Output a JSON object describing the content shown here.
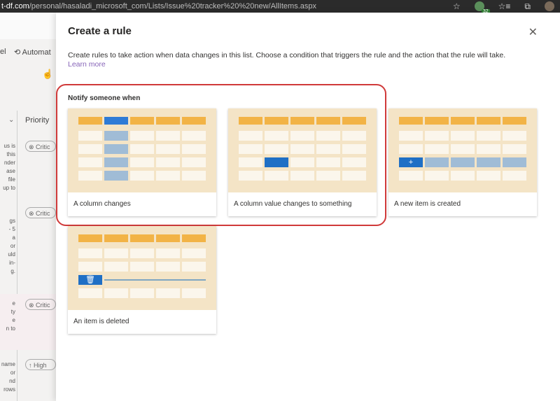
{
  "browser": {
    "url_domain": "t-df.com",
    "url_path": "/personal/hasaladi_microsoft_com/Lists/Issue%20tracker%20%20new/AllItems.aspx",
    "extension_badge": "32",
    "icons": [
      "star-icon",
      "extension-icon",
      "favorites-icon",
      "collections-icon",
      "profile-avatar"
    ]
  },
  "background": {
    "cmd_left": "el",
    "cmd_automate": "Automat",
    "column_priority": "Priority",
    "pills": [
      "⊗ Critic",
      "⊗ Critic",
      "⊗ Critic",
      "↑ High"
    ],
    "fragments": {
      "row1": [
        "us is",
        "this",
        "nder",
        "ase",
        "file",
        "up to"
      ],
      "row2": [
        "gs",
        "- 5",
        "a",
        "or",
        "uld",
        "in-",
        "g."
      ],
      "row3": [
        "e",
        "ty",
        "e",
        "n to"
      ],
      "row4": [
        "name",
        "or",
        "nd",
        "rows"
      ]
    }
  },
  "dialog": {
    "title": "Create a rule",
    "description": "Create rules to take action when data changes in this list. Choose a condition that triggers the rule and the action that the rule will take.",
    "learn_more": "Learn more",
    "section_label": "Notify someone when",
    "cards": [
      {
        "label": "A column changes"
      },
      {
        "label": "A column value changes to something"
      },
      {
        "label": "A new item is created"
      },
      {
        "label": "An item is deleted"
      }
    ]
  },
  "colors": {
    "highlight": "#d03a3a",
    "header_cell": "#f2b346",
    "accent_blue": "#1f6fc5",
    "thumb_bg": "#f4e4c6"
  }
}
